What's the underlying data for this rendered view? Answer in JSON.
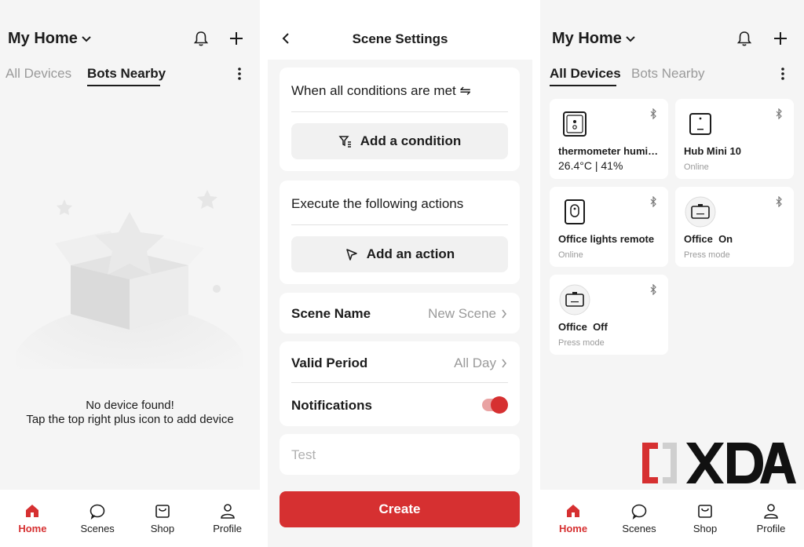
{
  "colors": {
    "accent": "#d63031",
    "muted": "#9a9a9a",
    "background": "#f5f5f5",
    "text": "#1c1c1c"
  },
  "home_left": {
    "title": "My Home",
    "tabs": [
      {
        "label": "All Devices",
        "active": false
      },
      {
        "label": "Bots Nearby",
        "active": true
      }
    ],
    "empty_state": {
      "line1": "No device found!",
      "line2": "Tap the top right plus icon to add device"
    }
  },
  "scene": {
    "title": "Scene Settings",
    "conditions_label": "When all conditions are met ⇋",
    "add_condition": "Add a condition",
    "actions_label": "Execute the following actions",
    "add_action": "Add an action",
    "scene_name_label": "Scene Name",
    "scene_name_value": "New Scene",
    "valid_period_label": "Valid Period",
    "valid_period_value": "All Day",
    "notifications_label": "Notifications",
    "notifications_on": true,
    "test_placeholder": "Test",
    "create_label": "Create"
  },
  "home_right": {
    "title": "My Home",
    "tabs": [
      {
        "label": "All Devices",
        "active": true
      },
      {
        "label": "Bots Nearby",
        "active": false
      }
    ],
    "devices": [
      {
        "name": "thermometer humi…",
        "reading": "26.4°C | 41%",
        "status": "",
        "icon": "thermometer-icon"
      },
      {
        "name": "Hub Mini 10",
        "status": "Online",
        "icon": "hub-icon"
      },
      {
        "name": "Office lights remote",
        "status": "Online",
        "icon": "remote-icon"
      },
      {
        "name": "Office  On",
        "status": "Press mode",
        "icon": "bot-icon"
      },
      {
        "name": "Office  Off",
        "status": "Press mode",
        "icon": "bot-icon"
      }
    ]
  },
  "bottom_nav": [
    {
      "label": "Home",
      "icon": "home-icon",
      "active": true
    },
    {
      "label": "Scenes",
      "icon": "scenes-icon",
      "active": false
    },
    {
      "label": "Shop",
      "icon": "shop-icon",
      "active": false
    },
    {
      "label": "Profile",
      "icon": "profile-icon",
      "active": false
    }
  ],
  "watermark": "XDA"
}
